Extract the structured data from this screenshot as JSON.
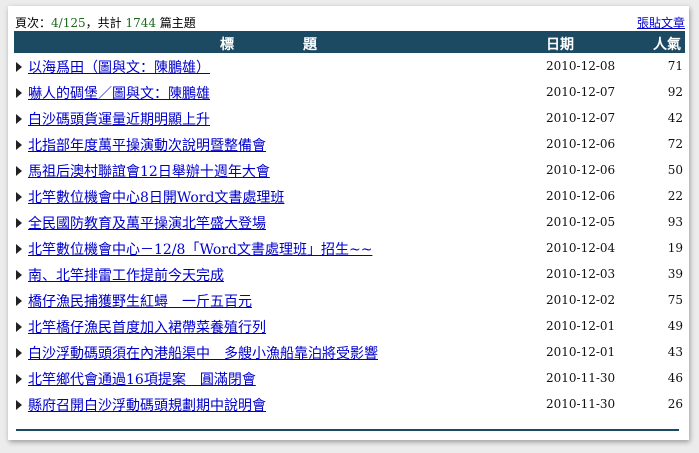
{
  "header": {
    "page_label": "頁次：",
    "page_value": "4/125",
    "total_prefix": "，共計 ",
    "total_count": "1744",
    "total_suffix": " 篇主題",
    "post_link": "張貼文章"
  },
  "columns": {
    "title_a": "標",
    "title_b": "題",
    "date": "日期",
    "popularity": "人氣"
  },
  "rows": [
    {
      "title": "以海爲田（圖與文：陳鵬雄）",
      "date": "2010-12-08",
      "views": "71"
    },
    {
      "title": "嚇人的碉堡／圖與文：陳鵬雄",
      "date": "2010-12-07",
      "views": "92"
    },
    {
      "title": "白沙碼頭貨運量近期明顯上升",
      "date": "2010-12-07",
      "views": "42"
    },
    {
      "title": "北指部年度萬平操演動次說明暨整備會",
      "date": "2010-12-06",
      "views": "72"
    },
    {
      "title": "馬祖后澳村聯誼會12日舉辦十週年大會",
      "date": "2010-12-06",
      "views": "50"
    },
    {
      "title": "北竿數位機會中心8日開Word文書處理班",
      "date": "2010-12-06",
      "views": "22"
    },
    {
      "title": "全民國防教育及萬平操演北竿盛大登場",
      "date": "2010-12-05",
      "views": "93"
    },
    {
      "title": "北竿數位機會中心－12/8「Word文書處理班」招生~~",
      "date": "2010-12-04",
      "views": "19"
    },
    {
      "title": "南、北竿排雷工作提前今天完成",
      "date": "2010-12-03",
      "views": "39"
    },
    {
      "title": "橋仔漁民捕獲野生紅蟳　一斤五百元",
      "date": "2010-12-02",
      "views": "75"
    },
    {
      "title": "北竿橋仔漁民首度加入裙帶菜養殖行列",
      "date": "2010-12-01",
      "views": "49"
    },
    {
      "title": "白沙浮動碼頭須在內港船渠中　多艘小漁船靠泊將受影響",
      "date": "2010-12-01",
      "views": "43"
    },
    {
      "title": "北竿鄉代會通過16項提案　圓滿閉會",
      "date": "2010-11-30",
      "views": "46"
    },
    {
      "title": "縣府召開白沙浮動碼頭規劃期中說明會",
      "date": "2010-11-30",
      "views": "26"
    }
  ]
}
